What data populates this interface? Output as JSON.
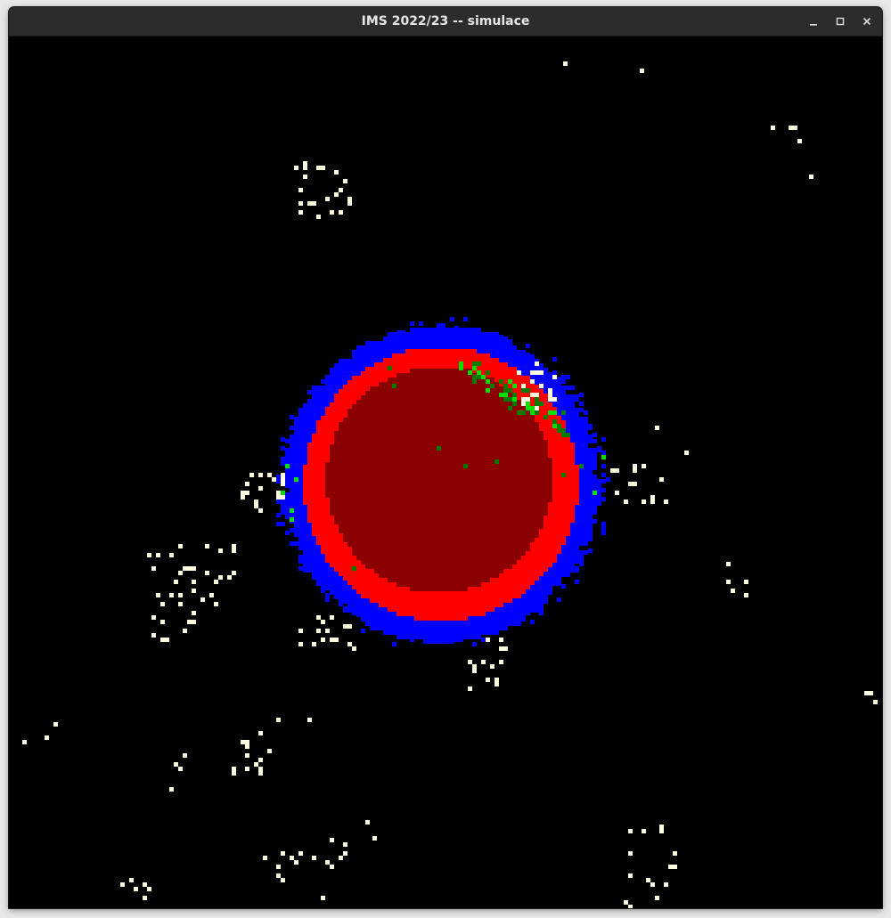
{
  "window": {
    "title": "IMS 2022/23 -- simulace",
    "controls": [
      {
        "name": "minimize",
        "icon": "minimize-icon"
      },
      {
        "name": "maximize",
        "icon": "maximize-icon"
      },
      {
        "name": "close",
        "icon": "close-icon"
      }
    ]
  },
  "simulation": {
    "background_color": "#000000",
    "colors": {
      "outer_zone": "#0000ff",
      "inner_ring": "#ff0000",
      "core": "#8b0000",
      "particles": "#fffde0",
      "green_bright": "#00e000",
      "green_dark": "#007a00"
    }
  }
}
